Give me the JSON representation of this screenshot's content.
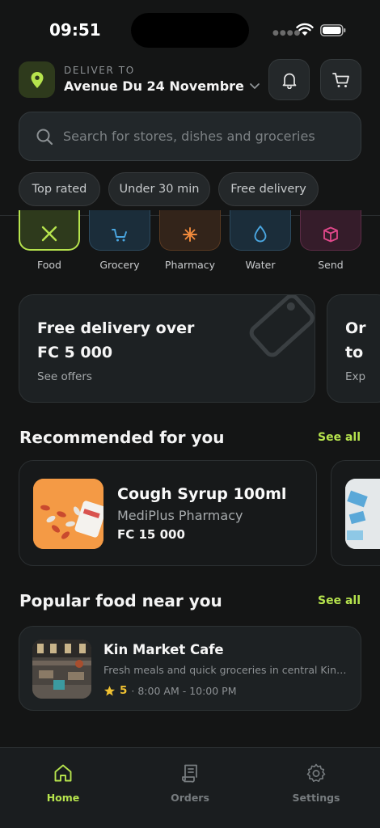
{
  "status": {
    "time": "09:51"
  },
  "header": {
    "deliver_label": "DELIVER TO",
    "address": "Avenue Du 24 Novembre"
  },
  "search": {
    "placeholder": "Search for stores, dishes and groceries"
  },
  "filters": [
    "Top rated",
    "Under 30 min",
    "Free delivery"
  ],
  "categories": [
    {
      "label": "Food",
      "icon": "utensils-icon",
      "color": "#b6e34d",
      "selected": true
    },
    {
      "label": "Grocery",
      "icon": "cart-icon",
      "color": "#4aa6e0"
    },
    {
      "label": "Pharmacy",
      "icon": "medical-icon",
      "color": "#f08a3c"
    },
    {
      "label": "Water",
      "icon": "droplet-icon",
      "color": "#4aa6e0"
    },
    {
      "label": "Send",
      "icon": "package-icon",
      "color": "#e0488a"
    }
  ],
  "promos": [
    {
      "title_line1": "Free delivery over",
      "title_line2": "FC 5 000",
      "link": "See offers"
    },
    {
      "title_line1": "Or",
      "title_line2": "to",
      "link": "Exp"
    }
  ],
  "recommended": {
    "title": "Recommended for you",
    "see_all": "See all",
    "items": [
      {
        "name": "Cough Syrup 100ml",
        "store": "MediPlus Pharmacy",
        "price": "FC 15 000"
      }
    ]
  },
  "popular": {
    "title": "Popular food near you",
    "see_all": "See all",
    "items": [
      {
        "name": "Kin Market Cafe",
        "description": "Fresh meals and quick groceries in central Kinshasa",
        "rating": "5",
        "hours": "· 8:00 AM - 10:00 PM"
      }
    ]
  },
  "tabs": [
    {
      "label": "Home",
      "icon": "home-icon",
      "active": true
    },
    {
      "label": "Orders",
      "icon": "receipt-icon"
    },
    {
      "label": "Settings",
      "icon": "gear-icon"
    }
  ],
  "colors": {
    "accent": "#b6e34d",
    "background": "#141515",
    "card": "#1d2123"
  }
}
